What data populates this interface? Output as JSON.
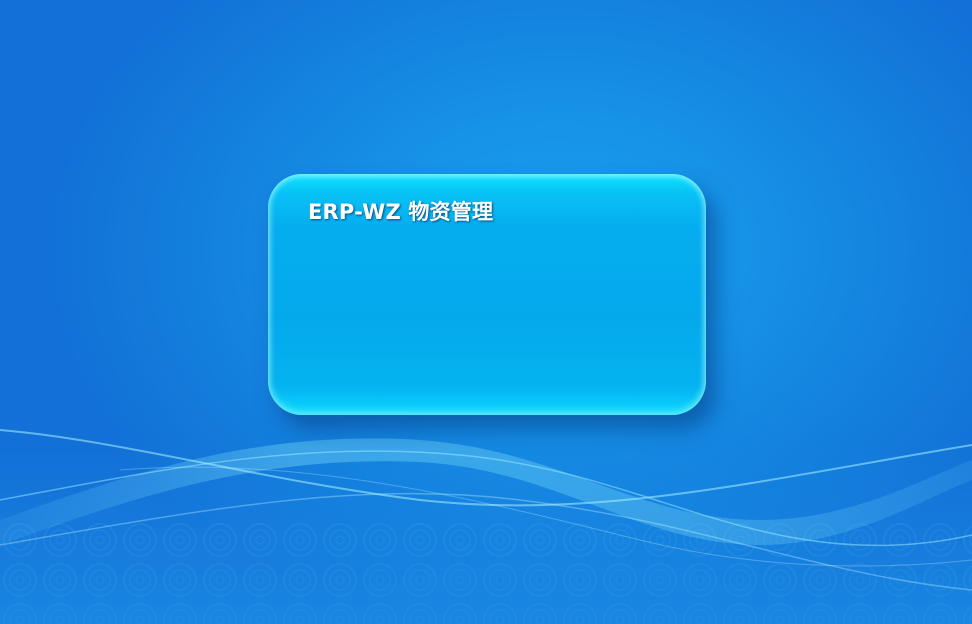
{
  "login_panel": {
    "title": "ERP-WZ 物资管理"
  },
  "colors": {
    "background": "#1690e6",
    "panel": "#04a9ec",
    "panel_edge": "#0be3ff",
    "title_text": "#ffffff"
  }
}
